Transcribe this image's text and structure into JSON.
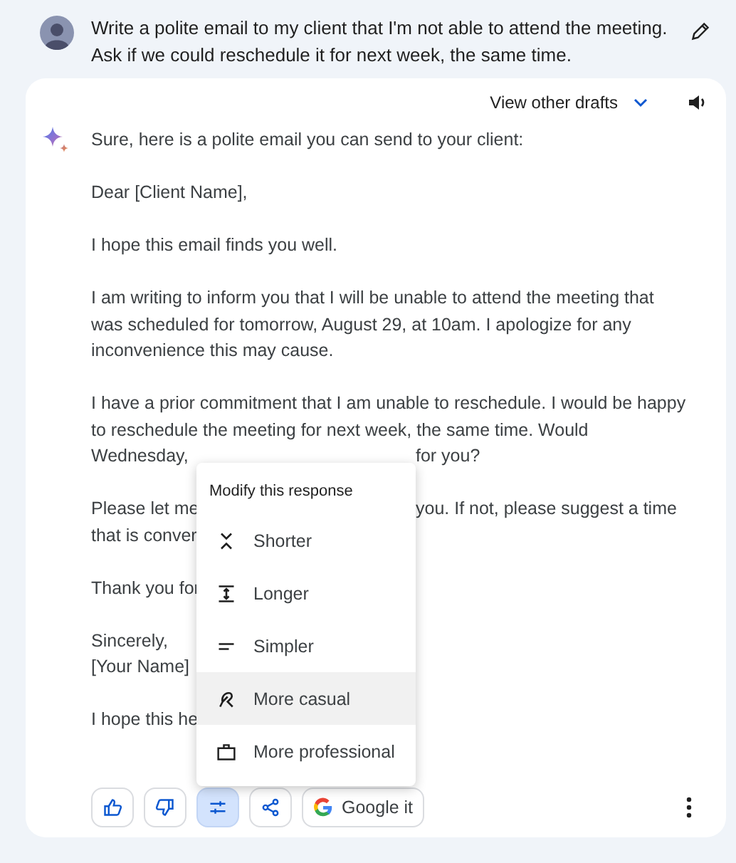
{
  "prompt": {
    "text": "Write a polite email to my client that I'm not able to attend the meeting. Ask if we could reschedule it for next week, the same time."
  },
  "response": {
    "drafts_label": "View other drafts",
    "intro": "Sure, here is a polite email you can send to your client:",
    "paragraphs": [
      {
        "lines": [
          {
            "kind": "full",
            "text": "Dear [Client Name],"
          }
        ]
      },
      {
        "lines": [
          {
            "kind": "full",
            "text": "I hope this email finds you well."
          }
        ]
      },
      {
        "lines": [
          {
            "kind": "full",
            "text": "I am writing to inform you that I will be unable to attend the meeting that"
          },
          {
            "kind": "full",
            "text": "was scheduled for tomorrow, August 29, at 10am. I apologize for any"
          },
          {
            "kind": "full",
            "text": "inconvenience this may cause."
          }
        ]
      },
      {
        "lines": [
          {
            "kind": "full",
            "text": "I have a prior commitment that I am unable to reschedule. I would be happy"
          },
          {
            "kind": "full",
            "text": "to reschedule the meeting for next week, the same time. Would"
          },
          {
            "kind": "split",
            "left": "Wednesday,",
            "right": "for you?"
          }
        ]
      },
      {
        "lines": [
          {
            "kind": "split",
            "left": "Please let me",
            "right": "you. If not, please suggest a time"
          },
          {
            "kind": "split",
            "left": "that is conver"
          }
        ]
      },
      {
        "lines": [
          {
            "kind": "split",
            "left": "Thank you for"
          }
        ]
      },
      {
        "lines": [
          {
            "kind": "full",
            "text": "Sincerely,"
          },
          {
            "kind": "full",
            "text": "[Your Name]"
          }
        ]
      },
      {
        "lines": [
          {
            "kind": "split",
            "left": "I hope this he"
          }
        ]
      }
    ]
  },
  "menu": {
    "title": "Modify this response",
    "items": [
      {
        "kind": "shorter",
        "label": "Shorter",
        "hovered": false
      },
      {
        "kind": "longer",
        "label": "Longer",
        "hovered": false
      },
      {
        "kind": "simpler",
        "label": "Simpler",
        "hovered": false
      },
      {
        "kind": "casual",
        "label": "More casual",
        "hovered": true
      },
      {
        "kind": "professional",
        "label": "More professional",
        "hovered": false
      }
    ]
  },
  "actions": [
    {
      "kind": "thumb-up",
      "selected": false
    },
    {
      "kind": "thumb-down",
      "selected": false
    },
    {
      "kind": "modify",
      "selected": true
    },
    {
      "kind": "share",
      "selected": false
    },
    {
      "kind": "google",
      "label": "Google it",
      "selected": false
    }
  ]
}
